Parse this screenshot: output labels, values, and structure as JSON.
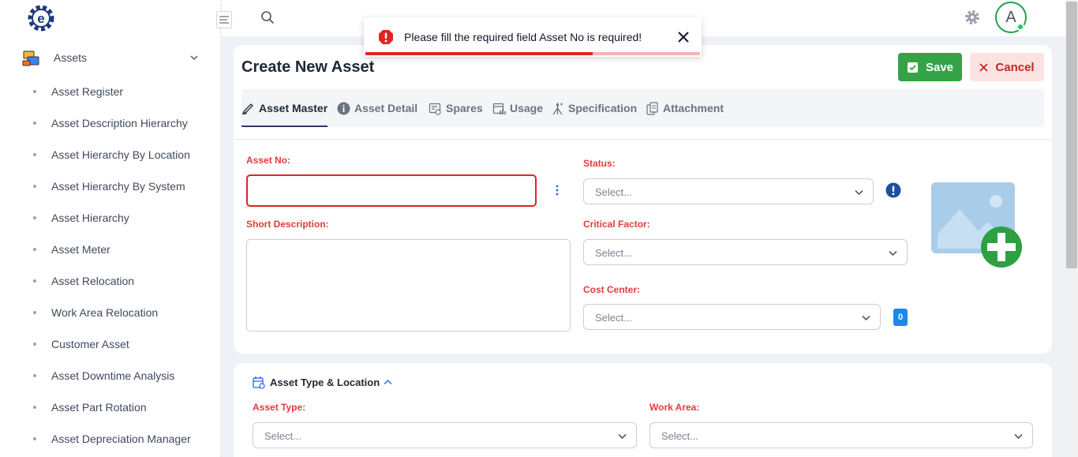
{
  "sidebar": {
    "module": {
      "label": "Assets"
    },
    "items": [
      {
        "label": "Asset Register"
      },
      {
        "label": "Asset Description Hierarchy"
      },
      {
        "label": "Asset Hierarchy By Location"
      },
      {
        "label": "Asset Hierarchy By System"
      },
      {
        "label": "Asset Hierarchy"
      },
      {
        "label": "Asset Meter"
      },
      {
        "label": "Asset Relocation"
      },
      {
        "label": "Work Area Relocation"
      },
      {
        "label": "Customer Asset"
      },
      {
        "label": "Asset Downtime Analysis"
      },
      {
        "label": "Asset Part Rotation"
      },
      {
        "label": "Asset Depreciation Manager"
      }
    ]
  },
  "header": {
    "avatar_letter": "A"
  },
  "toast": {
    "message": "Please fill the required field Asset No is required!",
    "progress": 0.68
  },
  "page": {
    "title": "Create New Asset",
    "save_label": "Save",
    "cancel_label": "Cancel"
  },
  "tabs": [
    {
      "label": "Asset Master",
      "active": true
    },
    {
      "label": "Asset Detail",
      "active": false
    },
    {
      "label": "Spares",
      "active": false
    },
    {
      "label": "Usage",
      "active": false
    },
    {
      "label": "Specification",
      "active": false
    },
    {
      "label": "Attachment",
      "active": false
    }
  ],
  "form": {
    "asset_no": {
      "label": "Asset No:",
      "value": ""
    },
    "short_description": {
      "label": "Short Description:",
      "value": ""
    },
    "status": {
      "label": "Status:",
      "placeholder": "Select..."
    },
    "critical_factor": {
      "label": "Critical Factor:",
      "placeholder": "Select..."
    },
    "cost_center": {
      "label": "Cost Center:",
      "placeholder": "Select...",
      "count": "0"
    }
  },
  "section2": {
    "title": "Asset Type & Location",
    "asset_type": {
      "label": "Asset Type:",
      "placeholder": "Select..."
    },
    "work_area": {
      "label": "Work Area:",
      "placeholder": "Select..."
    }
  },
  "colors": {
    "accent": "#2b3a67",
    "save": "#34a348",
    "cancel_bg": "#fde2e2",
    "error": "#e02424",
    "badge": "#1e88e5"
  }
}
